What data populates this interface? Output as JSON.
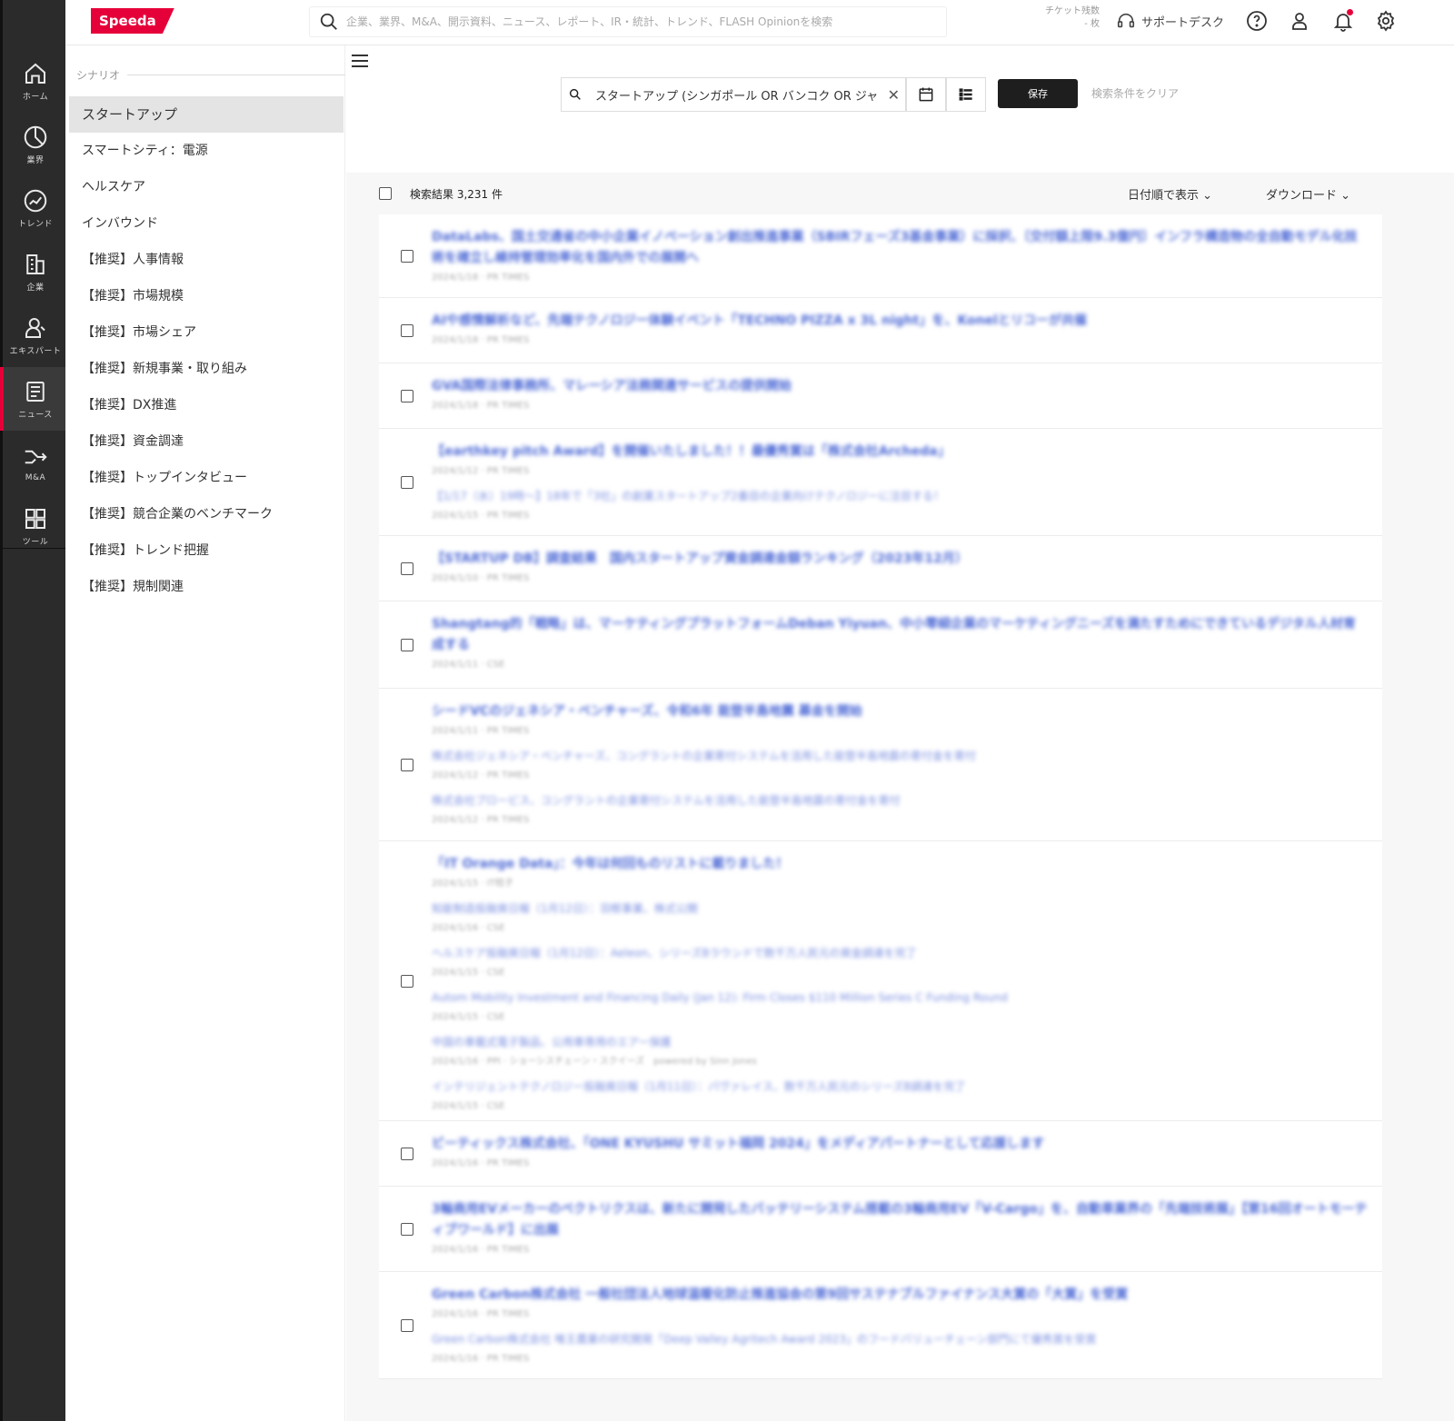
{
  "header": {
    "logo": "Speeda",
    "search_placeholder": "企業、業界、M&A、開示資料、ニュース、レポート、IR・統計、トレンド、FLASH Opinionを検索",
    "ticket_label": "チケット残数",
    "ticket_value": "- 枚",
    "support_label": "サポートデスク",
    "icons": [
      "help-icon",
      "user-icon",
      "bell-icon",
      "gear-icon"
    ],
    "accent": "#e60039"
  },
  "rail": {
    "items": [
      {
        "label": "ホーム",
        "icon": "home-icon"
      },
      {
        "label": "業界",
        "icon": "pie-icon"
      },
      {
        "label": "トレンド",
        "icon": "trend-icon"
      },
      {
        "label": "企業",
        "icon": "building-icon"
      },
      {
        "label": "エキスパート",
        "icon": "expert-icon"
      },
      {
        "label": "ニュース",
        "icon": "news-icon",
        "active": true
      },
      {
        "label": "M&A",
        "icon": "merge-icon"
      },
      {
        "label": "ツール",
        "icon": "grid-icon"
      }
    ]
  },
  "scenario": {
    "title": "シナリオ",
    "items": [
      "スタートアップ",
      "スマートシティ：電源",
      "ヘルスケア",
      "インバウンド",
      "【推奨】人事情報",
      "【推奨】市場規模",
      "【推奨】市場シェア",
      "【推奨】新規事業・取り組み",
      "【推奨】DX推進",
      "【推奨】資金調達",
      "【推奨】トップインタビュー",
      "【推奨】競合企業のベンチマーク",
      "【推奨】トレンド把握",
      "【推奨】規制関連"
    ],
    "selected_index": 0
  },
  "query": {
    "text": "スタートアップ (シンガポール OR バンコク OR ジャ",
    "save_label": "保存",
    "clear_label": "検索条件をクリア"
  },
  "results": {
    "count_label": "検索結果 3,231 件",
    "sort_label": "日付順で表示",
    "download_label": "ダウンロード",
    "cards": [
      {
        "entries": [
          {
            "title": "DataLabs、国土交通省の中小企業イノベーション創出推進事業（SBIRフェーズ3基金事業）に採択、〔交付額上限9.3億円〕インフラ構造物の全自動モデル化技術を確立し維持管理効率化を国内外での展開へ",
            "meta": "2024/1/18 · PR TIMES",
            "sub": false
          }
        ]
      },
      {
        "entries": [
          {
            "title": "AIや感情解析など、先端テクノロジー体験イベント「TECHNO PIZZA x 3L night」を、Konelとリコーが共催",
            "meta": "2024/1/18 · PR TIMES",
            "sub": false
          }
        ]
      },
      {
        "entries": [
          {
            "title": "GVA国際法律事務所、マレーシア法務関連サービスの提供開始",
            "meta": "2024/1/18 · PR TIMES",
            "sub": false
          }
        ]
      },
      {
        "entries": [
          {
            "title": "【earthkey pitch Award】を開催いたしました！！最優秀賞は「株式会社Archeda」",
            "meta": "2024/1/12 · PR TIMES",
            "sub": false
          },
          {
            "title": "【1/17（水）19時〜】18年で「3社」の創業スタートアップ2番目の企業向けテクノロジーに注目する！",
            "meta": "2024/1/15 · PR TIMES",
            "sub": true
          }
        ]
      },
      {
        "entries": [
          {
            "title": "【STARTUP DB】調査結果　国内スタートアップ資金調達金額ランキング（2023年12月）",
            "meta": "2024/1/10 · PR TIMES",
            "sub": false
          }
        ]
      },
      {
        "entries": [
          {
            "title": "Shangtang的「戦略」は、マーケティングプラットフォームDeban Yiyuan、中小零細企業のマーケティングニーズを満たすためにできているデジタル人材育成する",
            "meta": "2024/1/11 · CSE",
            "sub": false
          }
        ]
      },
      {
        "entries": [
          {
            "title": "シードVCのジェネシア・ベンチャーズ、令和6年 能登半島地震 募金を開始",
            "meta": "2024/1/11 · PR TIMES",
            "sub": false
          },
          {
            "title": "株式会社ジェネシア・ベンチャーズ、コングラントの企業寄付システムを活用した能登半島地震の寄付金を寄付",
            "meta": "2024/1/12 · PR TIMES",
            "sub": true
          },
          {
            "title": "株式会社プロービス、コングラントの企業寄付システムを活用した能登半島地震の寄付金を寄付",
            "meta": "2024/1/12 · PR TIMES",
            "sub": true
          }
        ]
      },
      {
        "entries": [
          {
            "title": "「IT Orange Data」：今年は何回ものリストに載りました！",
            "meta": "2024/1/15 · IT桔子",
            "sub": false
          },
          {
            "title": "知能制造投融資日報（1月12日）：羽根事業、株式公開",
            "meta": "2024/1/16 · CSE",
            "sub": true
          },
          {
            "title": "ヘルスケア投融資日報（1月12日）：Aeleon、シリーズBラウンドで数千万人民元の資金調達を完了",
            "meta": "2024/1/15 · CSE",
            "sub": true
          },
          {
            "title": "Autom Mobility Investment and Financing Daily (Jan 12): Firm Closes $110 Million Series C Funding Round",
            "meta": "2024/1/15 · CSE",
            "sub": true
          },
          {
            "title": "中国の車載式電子製品、公用車専用のエアー保護",
            "meta": "2024/1/16 · PPI · ショーシスチェーン・スクイーズ　powered by Sinn Jones",
            "sub": true
          },
          {
            "title": "インテリジェントテクノロジー投融資日報（1月11日）：パヴァレイス、数千万人民元のシリーズB調達を完了",
            "meta": "2024/1/15 · CSE",
            "sub": true
          }
        ]
      },
      {
        "entries": [
          {
            "title": "ビーティックス株式会社、「ONE KYUSHU サミット福岡 2024」をメディアパートナーとして応援します",
            "meta": "2024/1/16 · PR TIMES",
            "sub": false
          }
        ]
      },
      {
        "entries": [
          {
            "title": "3輪商用EVメーカーのベクトリクスは、新たに開発したバッテリーシステム搭載の3輪商用EV「V-Cargo」を、自動車業界の「先端技術展」【第16回オートモーティブワールド】に出展",
            "meta": "2024/1/16 · PR TIMES",
            "sub": false
          }
        ]
      },
      {
        "entries": [
          {
            "title": "Green Carbon株式会社 一般社団法人地球温暖化防止推進協会の第9回サステナブルファイナンス大賞の「大賞」を受賞",
            "meta": "2024/1/16 · PR TIMES",
            "sub": false
          },
          {
            "title": "Green Carbon株式会社 唯王農業の研究開発「Deep Valley Agritech Award 2023」のフードバリューチェーン部門にて優秀賞を受賞",
            "meta": "2024/1/16 · PR TIMES",
            "sub": true
          }
        ]
      }
    ]
  }
}
